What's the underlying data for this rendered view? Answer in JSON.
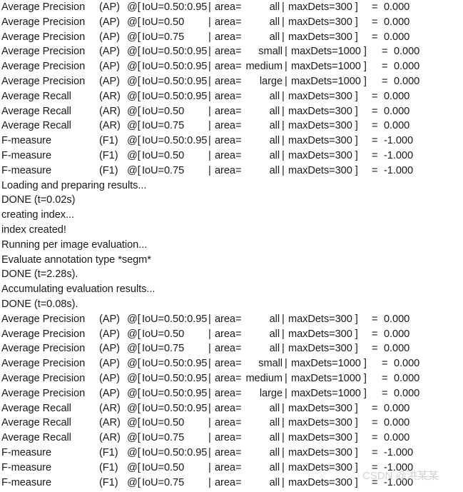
{
  "terminal": {
    "background_color": "#ffffff",
    "text_color": "#1a1a1a",
    "watermark": {
      "text": "CSDN @洪某某",
      "color": "#d2d2d2"
    }
  },
  "lines": [
    {
      "kind": "metric",
      "wide": false,
      "metric": "Average Precision",
      "tag": "(AP)",
      "at": "@[",
      "iou": "IoU=0.50:0.95",
      "bar1": "|",
      "area": "area=",
      "area_value": "all",
      "bar2": "|",
      "dets": "maxDets=300 ]",
      "eq": "=",
      "value": "0.000"
    },
    {
      "kind": "metric",
      "wide": false,
      "metric": "Average Precision",
      "tag": "(AP)",
      "at": "@[",
      "iou": "IoU=0.50",
      "bar1": "|",
      "area": "area=",
      "area_value": "all",
      "bar2": "|",
      "dets": "maxDets=300 ]",
      "eq": "=",
      "value": "0.000"
    },
    {
      "kind": "metric",
      "wide": false,
      "metric": "Average Precision",
      "tag": "(AP)",
      "at": "@[",
      "iou": "IoU=0.75",
      "bar1": "|",
      "area": "area=",
      "area_value": "all",
      "bar2": "|",
      "dets": "maxDets=300 ]",
      "eq": "=",
      "value": "0.000"
    },
    {
      "kind": "metric",
      "wide": true,
      "metric": "Average Precision",
      "tag": "(AP)",
      "at": "@[",
      "iou": "IoU=0.50:0.95",
      "bar1": "|",
      "area": "area=",
      "area_value": "small",
      "bar2": "|",
      "dets": "maxDets=1000 ]",
      "eq": "=",
      "value": "0.000"
    },
    {
      "kind": "metric",
      "wide": true,
      "metric": "Average Precision",
      "tag": "(AP)",
      "at": "@[",
      "iou": "IoU=0.50:0.95",
      "bar1": "|",
      "area": "area=",
      "area_value": "medium",
      "bar2": "|",
      "dets": "maxDets=1000 ]",
      "eq": "=",
      "value": "0.000"
    },
    {
      "kind": "metric",
      "wide": true,
      "metric": "Average Precision",
      "tag": "(AP)",
      "at": "@[",
      "iou": "IoU=0.50:0.95",
      "bar1": "|",
      "area": "area=",
      "area_value": "large",
      "bar2": "|",
      "dets": "maxDets=1000 ]",
      "eq": "=",
      "value": "0.000"
    },
    {
      "kind": "metric",
      "wide": false,
      "metric": "Average Recall",
      "tag": "(AR)",
      "at": "@[",
      "iou": "IoU=0.50:0.95",
      "bar1": "|",
      "area": "area=",
      "area_value": "all",
      "bar2": "|",
      "dets": "maxDets=300 ]",
      "eq": "=",
      "value": "0.000"
    },
    {
      "kind": "metric",
      "wide": false,
      "metric": "Average Recall",
      "tag": "(AR)",
      "at": "@[",
      "iou": "IoU=0.50",
      "bar1": "|",
      "area": "area=",
      "area_value": "all",
      "bar2": "|",
      "dets": "maxDets=300 ]",
      "eq": "=",
      "value": "0.000"
    },
    {
      "kind": "metric",
      "wide": false,
      "metric": "Average Recall",
      "tag": "(AR)",
      "at": "@[",
      "iou": "IoU=0.75",
      "bar1": "|",
      "area": "area=",
      "area_value": "all",
      "bar2": "|",
      "dets": "maxDets=300 ]",
      "eq": "=",
      "value": "0.000"
    },
    {
      "kind": "metric",
      "wide": false,
      "metric": "F-measure",
      "tag": "(F1)",
      "at": "@[",
      "iou": "IoU=0.50:0.95",
      "bar1": "|",
      "area": "area=",
      "area_value": "all",
      "bar2": "|",
      "dets": "maxDets=300 ]",
      "eq": "=",
      "value": "-1.000"
    },
    {
      "kind": "metric",
      "wide": false,
      "metric": "F-measure",
      "tag": "(F1)",
      "at": "@[",
      "iou": "IoU=0.50",
      "bar1": "|",
      "area": "area=",
      "area_value": "all",
      "bar2": "|",
      "dets": "maxDets=300 ]",
      "eq": "=",
      "value": "-1.000"
    },
    {
      "kind": "metric",
      "wide": false,
      "metric": "F-measure",
      "tag": "(F1)",
      "at": "@[",
      "iou": "IoU=0.75",
      "bar1": "|",
      "area": "area=",
      "area_value": "all",
      "bar2": "|",
      "dets": "maxDets=300 ]",
      "eq": "=",
      "value": "-1.000"
    },
    {
      "kind": "status",
      "text": "Loading and preparing results..."
    },
    {
      "kind": "status",
      "text": "DONE (t=0.02s)"
    },
    {
      "kind": "status",
      "text": "creating index..."
    },
    {
      "kind": "status",
      "text": "index created!"
    },
    {
      "kind": "status",
      "text": "Running per image evaluation..."
    },
    {
      "kind": "status",
      "text": "Evaluate annotation type *segm*"
    },
    {
      "kind": "status",
      "text": "DONE (t=2.28s)."
    },
    {
      "kind": "status",
      "text": "Accumulating evaluation results..."
    },
    {
      "kind": "status",
      "text": "DONE (t=0.08s)."
    },
    {
      "kind": "metric",
      "wide": false,
      "metric": "Average Precision",
      "tag": "(AP)",
      "at": "@[",
      "iou": "IoU=0.50:0.95",
      "bar1": "|",
      "area": "area=",
      "area_value": "all",
      "bar2": "|",
      "dets": "maxDets=300 ]",
      "eq": "=",
      "value": "0.000"
    },
    {
      "kind": "metric",
      "wide": false,
      "metric": "Average Precision",
      "tag": "(AP)",
      "at": "@[",
      "iou": "IoU=0.50",
      "bar1": "|",
      "area": "area=",
      "area_value": "all",
      "bar2": "|",
      "dets": "maxDets=300 ]",
      "eq": "=",
      "value": "0.000"
    },
    {
      "kind": "metric",
      "wide": false,
      "metric": "Average Precision",
      "tag": "(AP)",
      "at": "@[",
      "iou": "IoU=0.75",
      "bar1": "|",
      "area": "area=",
      "area_value": "all",
      "bar2": "|",
      "dets": "maxDets=300 ]",
      "eq": "=",
      "value": "0.000"
    },
    {
      "kind": "metric",
      "wide": true,
      "metric": "Average Precision",
      "tag": "(AP)",
      "at": "@[",
      "iou": "IoU=0.50:0.95",
      "bar1": "|",
      "area": "area=",
      "area_value": "small",
      "bar2": "|",
      "dets": "maxDets=1000 ]",
      "eq": "=",
      "value": "0.000"
    },
    {
      "kind": "metric",
      "wide": true,
      "metric": "Average Precision",
      "tag": "(AP)",
      "at": "@[",
      "iou": "IoU=0.50:0.95",
      "bar1": "|",
      "area": "area=",
      "area_value": "medium",
      "bar2": "|",
      "dets": "maxDets=1000 ]",
      "eq": "=",
      "value": "0.000"
    },
    {
      "kind": "metric",
      "wide": true,
      "metric": "Average Precision",
      "tag": "(AP)",
      "at": "@[",
      "iou": "IoU=0.50:0.95",
      "bar1": "|",
      "area": "area=",
      "area_value": "large",
      "bar2": "|",
      "dets": "maxDets=1000 ]",
      "eq": "=",
      "value": "0.000"
    },
    {
      "kind": "metric",
      "wide": false,
      "metric": "Average Recall",
      "tag": "(AR)",
      "at": "@[",
      "iou": "IoU=0.50:0.95",
      "bar1": "|",
      "area": "area=",
      "area_value": "all",
      "bar2": "|",
      "dets": "maxDets=300 ]",
      "eq": "=",
      "value": "0.000"
    },
    {
      "kind": "metric",
      "wide": false,
      "metric": "Average Recall",
      "tag": "(AR)",
      "at": "@[",
      "iou": "IoU=0.50",
      "bar1": "|",
      "area": "area=",
      "area_value": "all",
      "bar2": "|",
      "dets": "maxDets=300 ]",
      "eq": "=",
      "value": "0.000"
    },
    {
      "kind": "metric",
      "wide": false,
      "metric": "Average Recall",
      "tag": "(AR)",
      "at": "@[",
      "iou": "IoU=0.75",
      "bar1": "|",
      "area": "area=",
      "area_value": "all",
      "bar2": "|",
      "dets": "maxDets=300 ]",
      "eq": "=",
      "value": "0.000"
    },
    {
      "kind": "metric",
      "wide": false,
      "metric": "F-measure",
      "tag": "(F1)",
      "at": "@[",
      "iou": "IoU=0.50:0.95",
      "bar1": "|",
      "area": "area=",
      "area_value": "all",
      "bar2": "|",
      "dets": "maxDets=300 ]",
      "eq": "=",
      "value": "-1.000"
    },
    {
      "kind": "metric",
      "wide": false,
      "metric": "F-measure",
      "tag": "(F1)",
      "at": "@[",
      "iou": "IoU=0.50",
      "bar1": "|",
      "area": "area=",
      "area_value": "all",
      "bar2": "|",
      "dets": "maxDets=300 ]",
      "eq": "=",
      "value": "-1.000"
    },
    {
      "kind": "metric",
      "wide": false,
      "metric": "F-measure",
      "tag": "(F1)",
      "at": "@[",
      "iou": "IoU=0.75",
      "bar1": "|",
      "area": "area=",
      "area_value": "all",
      "bar2": "|",
      "dets": "maxDets=300 ]",
      "eq": "=",
      "value": "-1.000"
    }
  ]
}
